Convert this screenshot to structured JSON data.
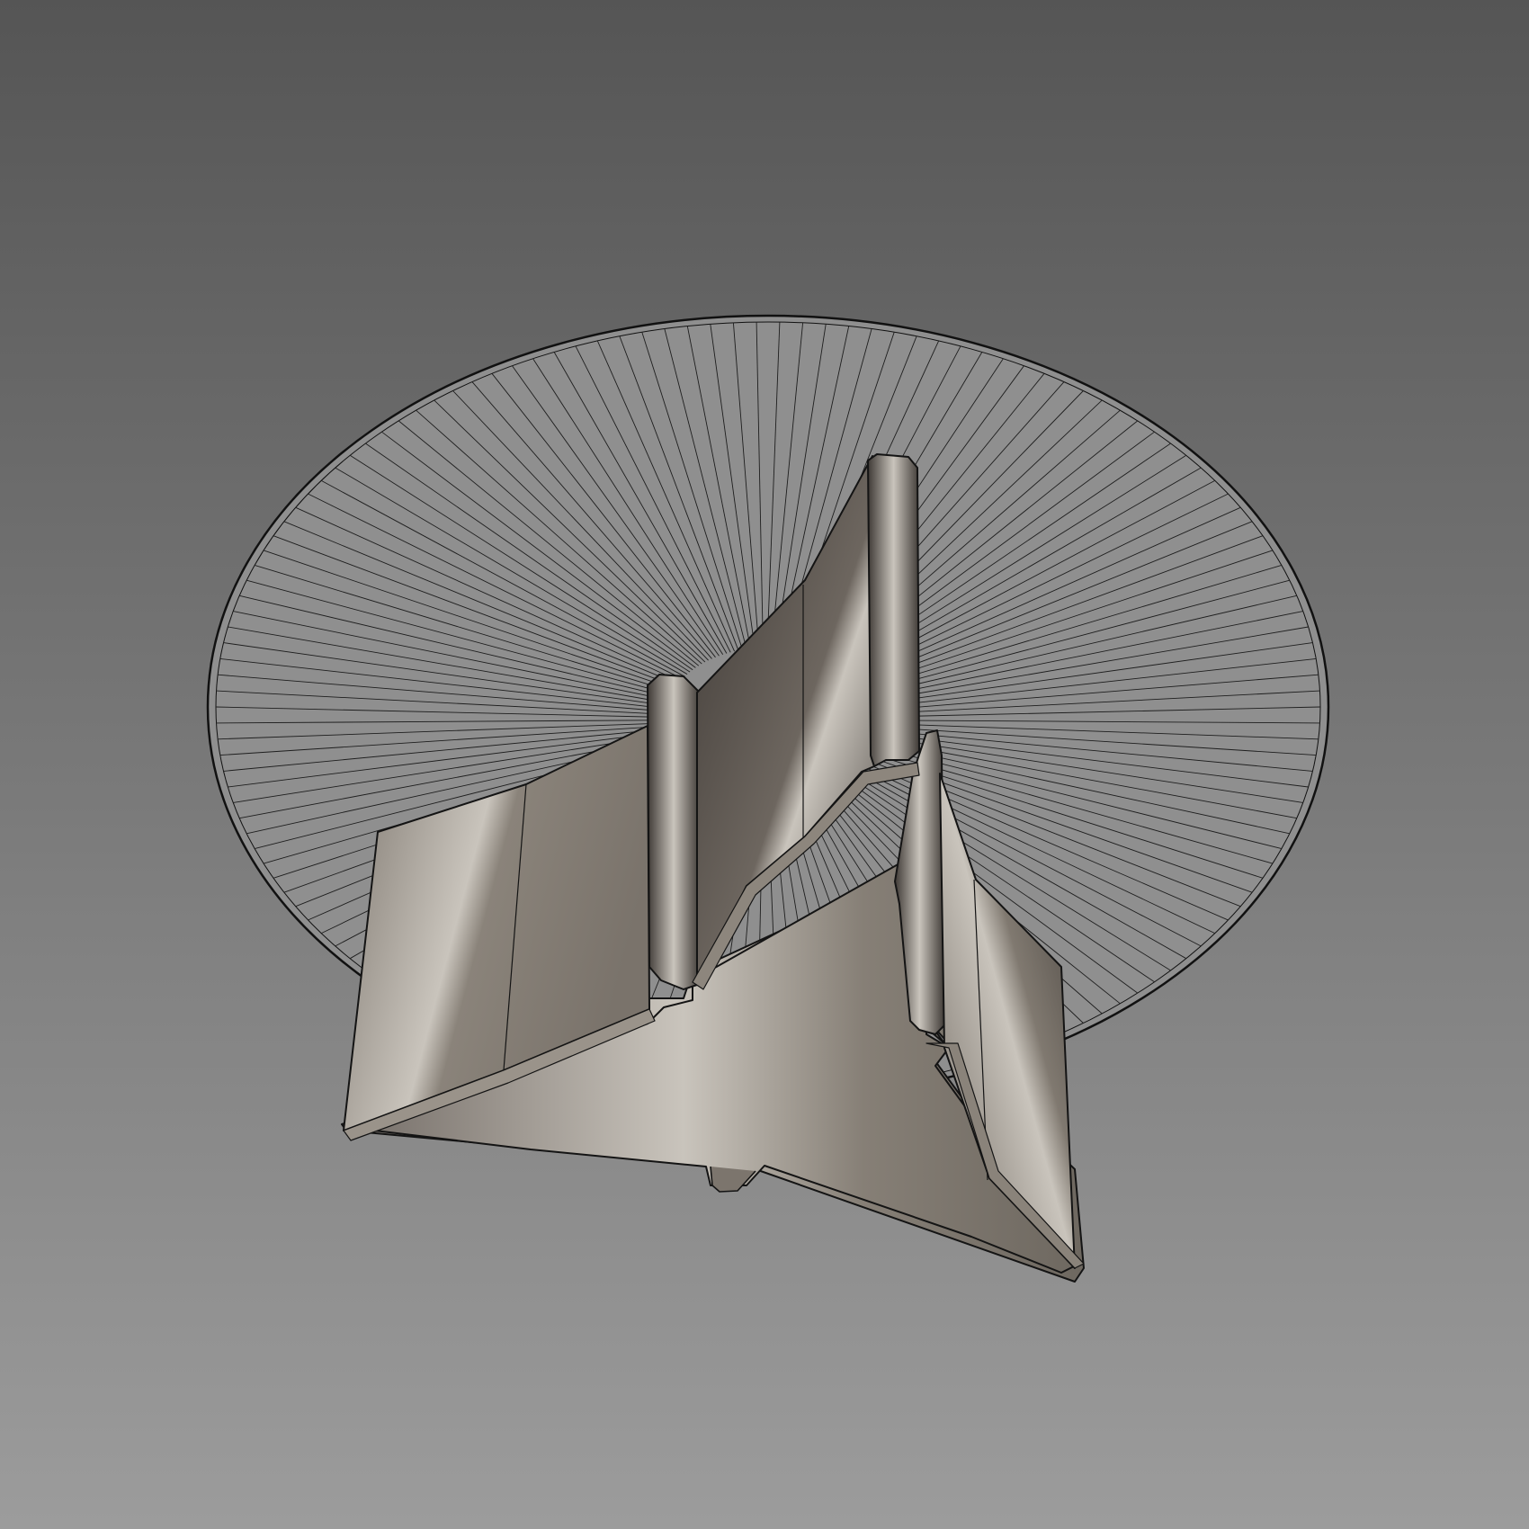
{
  "viewport": {
    "background_top_color": "#555555",
    "background_bottom_color": "#9c9c9c"
  },
  "model": {
    "disc": {
      "fill_color": "#8f8f8f",
      "edge_color": "#111111",
      "spoke_color": "#1e1e1e",
      "spoke_count": 150
    },
    "part": {
      "metal_dark_color": "#3f3a36",
      "metal_mid_color": "#7b746c",
      "metal_light_color": "#c9c4bc",
      "edge_color": "#141414"
    }
  }
}
